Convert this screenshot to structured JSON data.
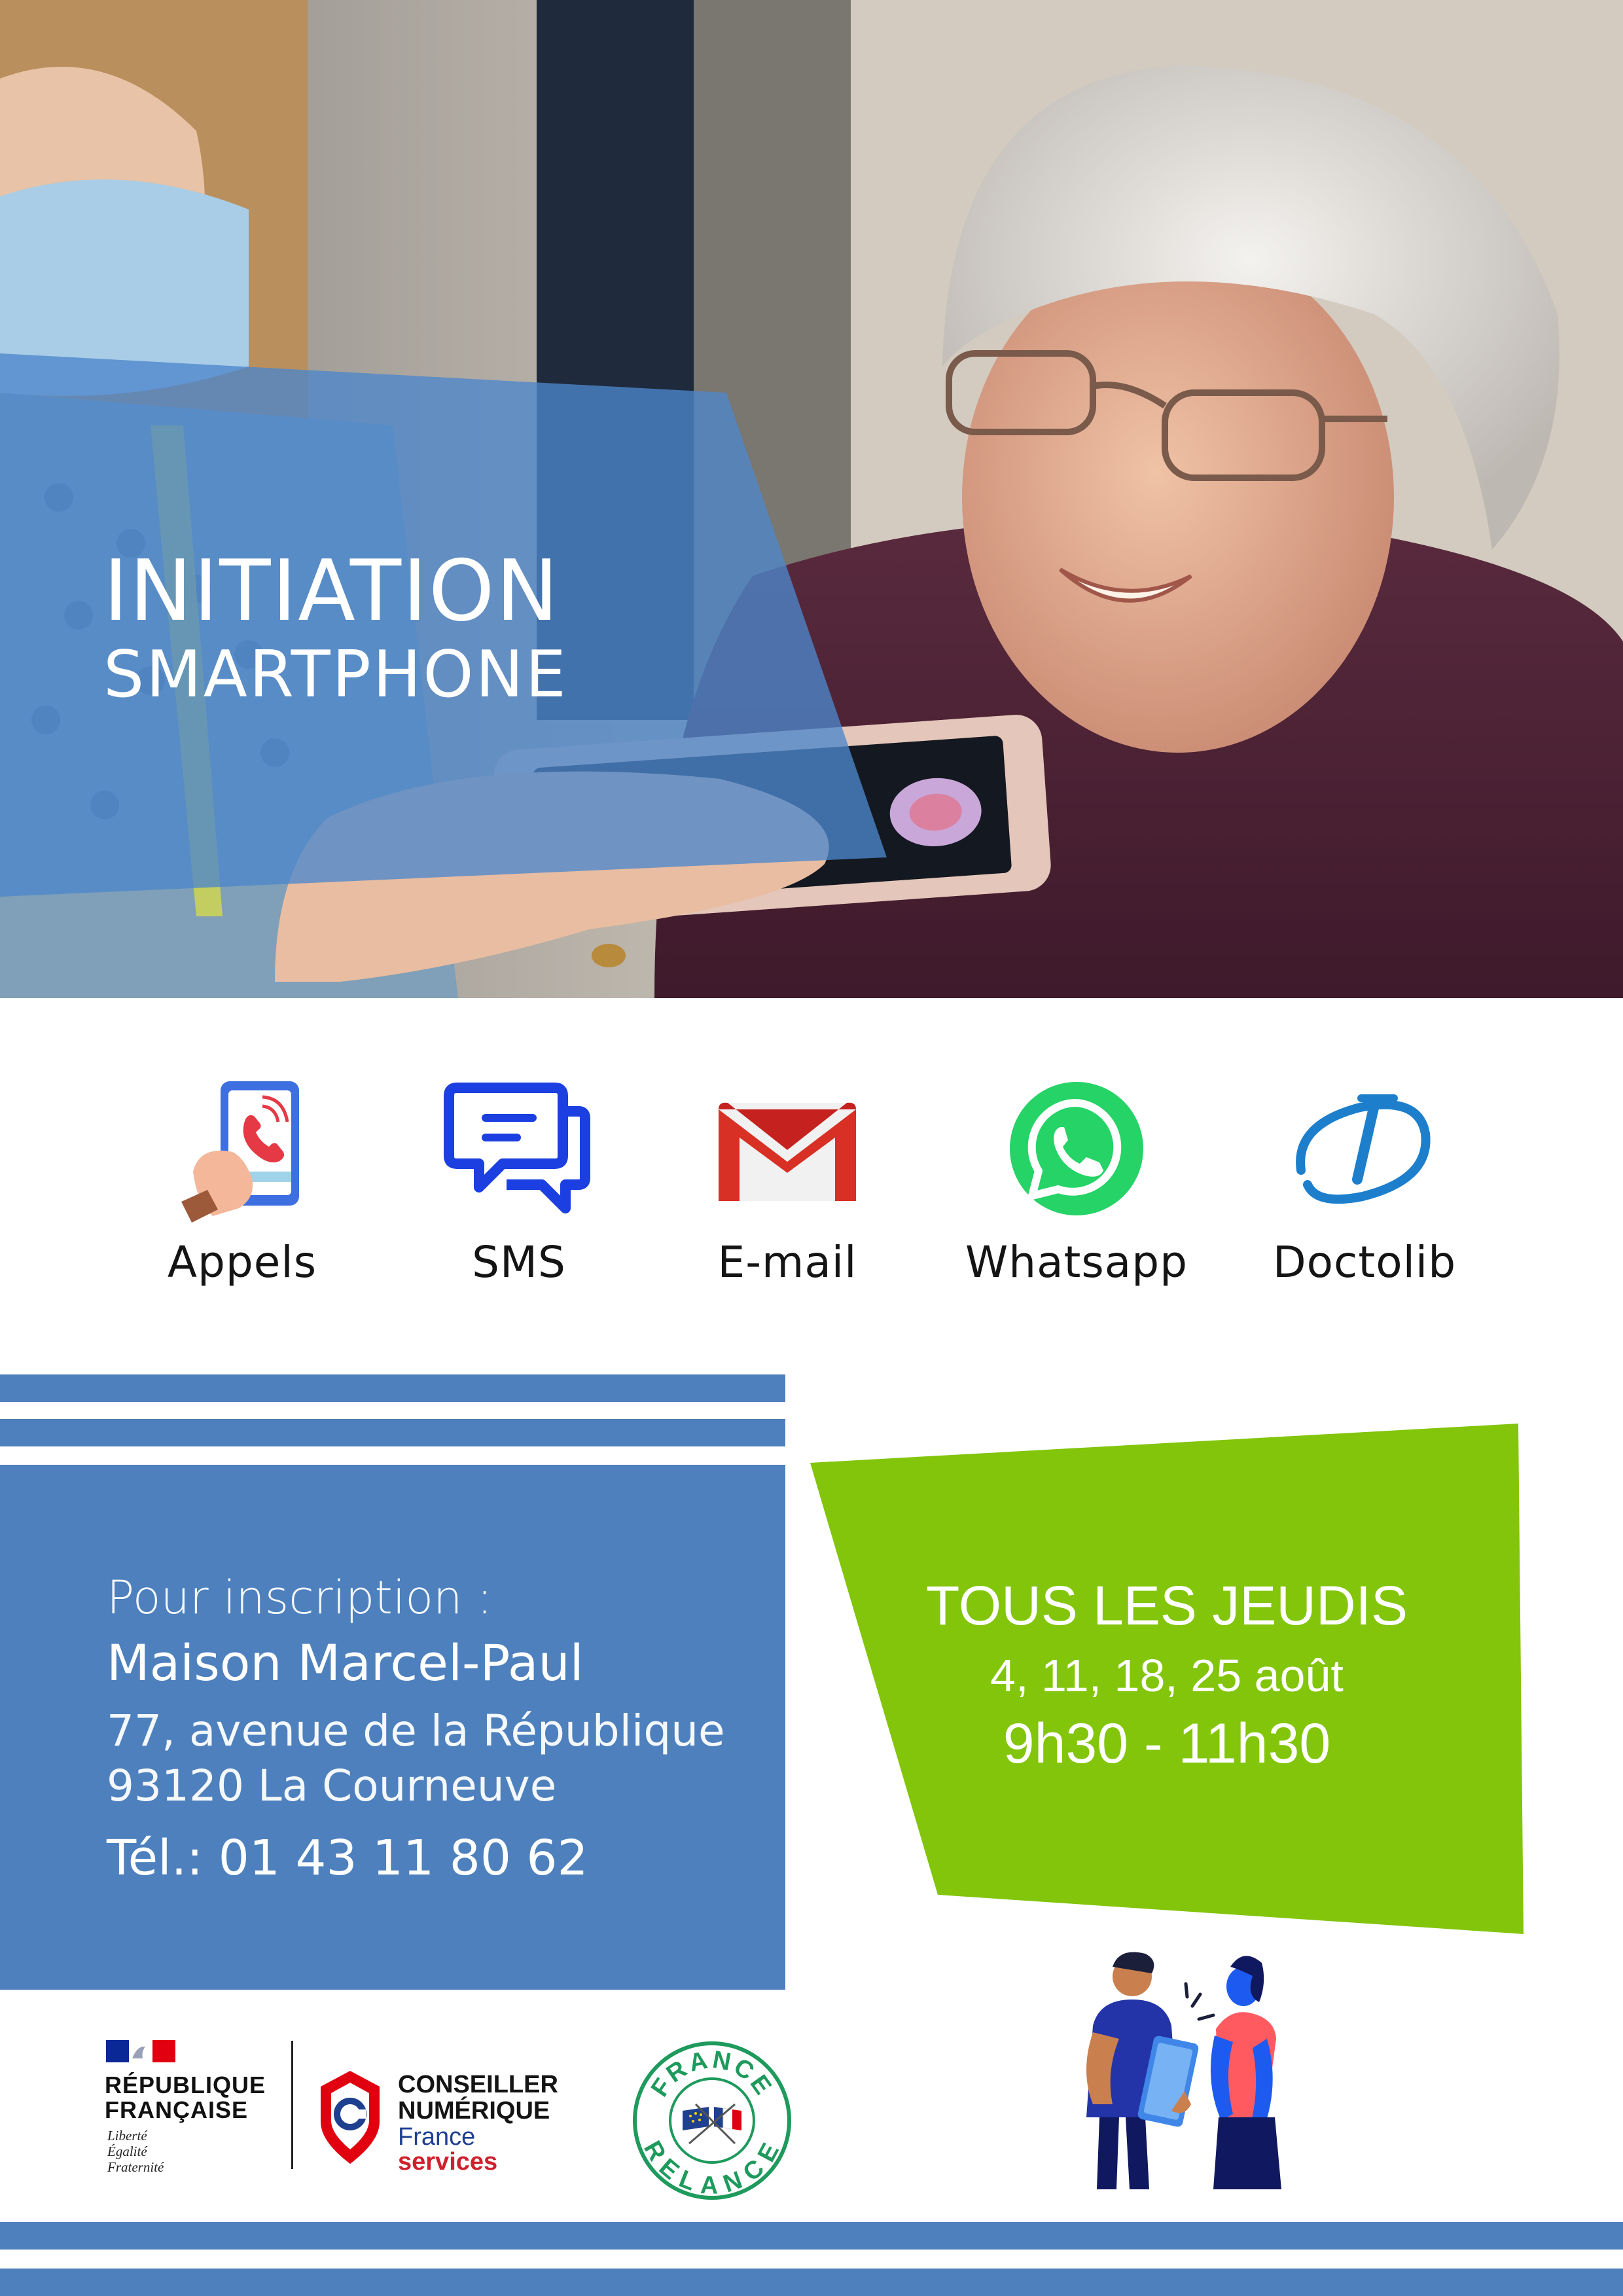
{
  "hero": {
    "title_line1": "INITIATION",
    "title_line2": "SMARTPHONE"
  },
  "apps": [
    {
      "label": "Appels",
      "icon": "phone-call-icon"
    },
    {
      "label": "SMS",
      "icon": "chat-bubbles-icon"
    },
    {
      "label": "E-mail",
      "icon": "gmail-icon"
    },
    {
      "label": "Whatsapp",
      "icon": "whatsapp-icon"
    },
    {
      "label": "Doctolib",
      "icon": "doctolib-icon"
    }
  ],
  "info": {
    "line1": "Pour inscription :",
    "line2": "Maison Marcel-Paul",
    "line3": "77, avenue de la République",
    "line4": "93120 La Courneuve",
    "line5": "Tél.: 01 43 11 80 62"
  },
  "schedule": {
    "line1": "TOUS LES JEUDIS",
    "line2": "4, 11, 18, 25 août",
    "line3": "9h30 - 11h30"
  },
  "logos": {
    "rf_line1": "RÉPUBLIQUE",
    "rf_line2": "FRANÇAISE",
    "rf_motto1": "Liberté",
    "rf_motto2": "Égalité",
    "rf_motto3": "Fraternité",
    "cn_line1": "CONSEILLER",
    "cn_line2": "NUMÉRIQUE",
    "cn_line3": "France",
    "cn_line4": "services",
    "relance_top": "FRANCE",
    "relance_bottom": "RELANCE"
  },
  "colors": {
    "blue": "#4d80bd",
    "green": "#82c50a",
    "text_dark": "#141414"
  }
}
